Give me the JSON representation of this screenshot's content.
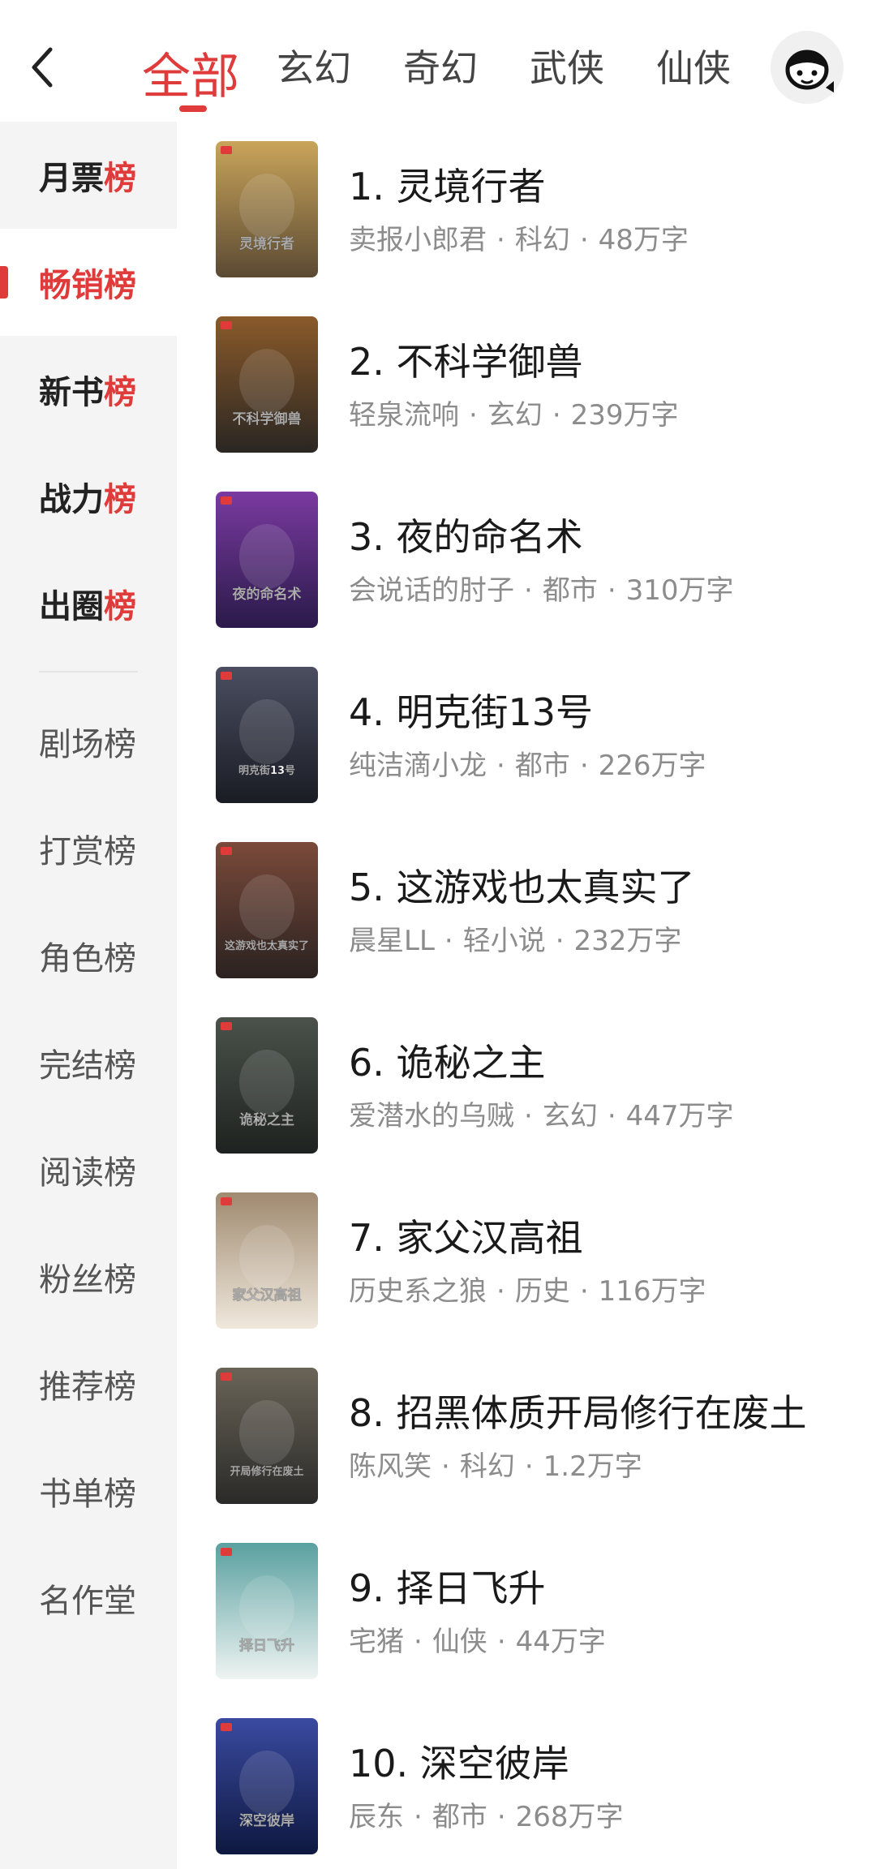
{
  "header": {
    "tabs": [
      "全部",
      "玄幻",
      "奇幻",
      "武侠",
      "仙侠"
    ],
    "active_tab": 0
  },
  "sidebar": {
    "primary": [
      {
        "label_a": "月票",
        "label_b": "榜"
      },
      {
        "label_a": "畅销",
        "label_b": "榜"
      },
      {
        "label_a": "新书",
        "label_b": "榜"
      },
      {
        "label_a": "战力",
        "label_b": "榜"
      },
      {
        "label_a": "出圈",
        "label_b": "榜"
      }
    ],
    "secondary": [
      "剧场榜",
      "打赏榜",
      "角色榜",
      "完结榜",
      "阅读榜",
      "粉丝榜",
      "推荐榜",
      "书单榜",
      "名作堂"
    ],
    "active_index": 1
  },
  "books": [
    {
      "title": "1. 灵境行者",
      "author": "卖报小郎君",
      "genre": "科幻",
      "words": "48万字",
      "cover_text": "灵境行者",
      "cover_colors": [
        "#5b4a33",
        "#c9a45a"
      ]
    },
    {
      "title": "2. 不科学御兽",
      "author": "轻泉流响",
      "genre": "玄幻",
      "words": "239万字",
      "cover_text": "不科学御兽",
      "cover_colors": [
        "#2a2622",
        "#8a5a2a"
      ]
    },
    {
      "title": "3. 夜的命名术",
      "author": "会说话的肘子",
      "genre": "都市",
      "words": "310万字",
      "cover_text": "夜的命名术",
      "cover_colors": [
        "#2a1a4a",
        "#7a3aa0"
      ]
    },
    {
      "title": "4. 明克街13号",
      "author": "纯洁滴小龙",
      "genre": "都市",
      "words": "226万字",
      "cover_text": "明克街13号",
      "cover_colors": [
        "#1a1c24",
        "#4a4e60"
      ]
    },
    {
      "title": "5. 这游戏也太真实了",
      "author": "晨星LL",
      "genre": "轻小说",
      "words": "232万字",
      "cover_text": "这游戏也太真实了",
      "cover_colors": [
        "#2a2220",
        "#7a4a3a"
      ]
    },
    {
      "title": "6. 诡秘之主",
      "author": "爱潜水的乌贼",
      "genre": "玄幻",
      "words": "447万字",
      "cover_text": "诡秘之主",
      "cover_colors": [
        "#1e2220",
        "#4a524a"
      ]
    },
    {
      "title": "7. 家父汉高祖",
      "author": "历史系之狼",
      "genre": "历史",
      "words": "116万字",
      "cover_text": "家父汉高祖",
      "cover_colors": [
        "#efe8dc",
        "#a08a70"
      ]
    },
    {
      "title": "8. 招黑体质开局修行在废土",
      "author": "陈风笑",
      "genre": "科幻",
      "words": "1.2万字",
      "cover_text": "开局修行在废土",
      "cover_colors": [
        "#2a2a28",
        "#6a6458"
      ]
    },
    {
      "title": "9. 择日飞升",
      "author": "宅猪",
      "genre": "仙侠",
      "words": "44万字",
      "cover_text": "择日飞升",
      "cover_colors": [
        "#eef4f2",
        "#5aa0a0"
      ]
    },
    {
      "title": "10. 深空彼岸",
      "author": "辰东",
      "genre": "都市",
      "words": "268万字",
      "cover_text": "深空彼岸",
      "cover_colors": [
        "#0e1840",
        "#3a4aa0"
      ]
    }
  ],
  "colors": {
    "accent": "#e03b3b",
    "sidebar_bg": "#f4f4f4",
    "meta_text": "#8c8c8c"
  }
}
